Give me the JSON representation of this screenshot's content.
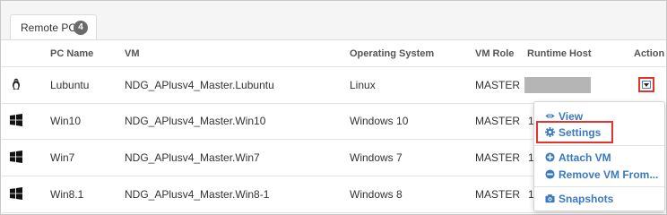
{
  "tab": {
    "label": "Remote PC",
    "count": "4"
  },
  "columns": {
    "pc_name": "PC Name",
    "vm": "VM",
    "os": "Operating System",
    "role": "VM Role",
    "host": "Runtime Host",
    "action": "Action"
  },
  "rows": [
    {
      "os_icon": "linux-icon",
      "pc_name": "Lubuntu",
      "vm": "NDG_APlusv4_Master.Lubuntu",
      "os": "Linux",
      "role": "MASTER",
      "host": ""
    },
    {
      "os_icon": "windows-icon",
      "pc_name": "Win10",
      "vm": "NDG_APlusv4_Master.Win10",
      "os": "Windows 10",
      "role": "MASTER",
      "host": "1"
    },
    {
      "os_icon": "windows-icon",
      "pc_name": "Win7",
      "vm": "NDG_APlusv4_Master.Win7",
      "os": "Windows 7",
      "role": "MASTER",
      "host": "1"
    },
    {
      "os_icon": "windows-icon",
      "pc_name": "Win8.1",
      "vm": "NDG_APlusv4_Master.Win8-1",
      "os": "Windows 8",
      "role": "MASTER",
      "host": "1"
    }
  ],
  "menu": {
    "view": "View",
    "settings": "Settings",
    "attach_vm": "Attach VM",
    "remove_vm": "Remove VM From...",
    "snapshots": "Snapshots"
  },
  "colors": {
    "accent": "#3a7ac0",
    "highlight": "#e3342f",
    "badge": "#6b6b6b"
  }
}
